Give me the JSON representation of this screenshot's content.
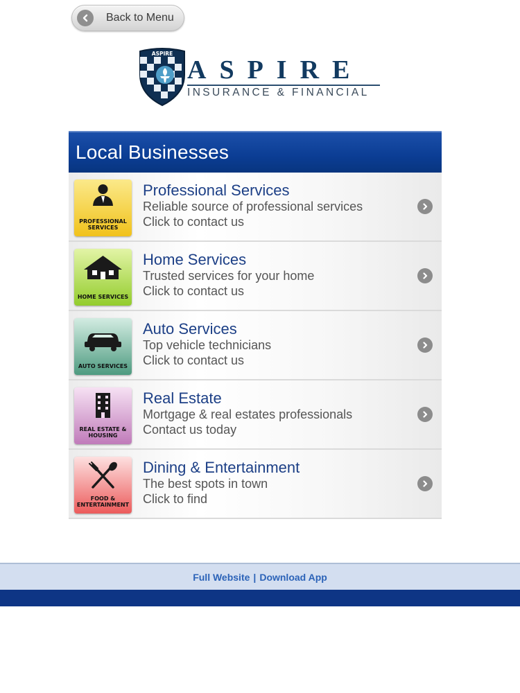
{
  "nav": {
    "back_label": "Back to Menu",
    "back_icon": "arrow-left-icon"
  },
  "logo": {
    "shield_text": "ASPIRE",
    "name": "ASPIRE",
    "tagline": "INSURANCE & FINANCIAL"
  },
  "section": {
    "title": "Local Businesses"
  },
  "items": [
    {
      "title": "Professional Services",
      "subtitle": "Reliable source of professional services",
      "action": "Click to contact us",
      "thumb_caption": "PROFESSIONAL SERVICES",
      "thumb_color": "#f7d23b",
      "icon": "businessman-icon"
    },
    {
      "title": "Home Services",
      "subtitle": "Trusted services for your home",
      "action": "Click to contact us",
      "thumb_caption": "HOME SERVICES",
      "thumb_color": "#a9d84a",
      "icon": "house-icon"
    },
    {
      "title": "Auto Services",
      "subtitle": "Top vehicle technicians",
      "action": "Click to contact us",
      "thumb_caption": "AUTO SERVICES",
      "thumb_color": "#5fa98f",
      "icon": "car-icon"
    },
    {
      "title": "Real Estate",
      "subtitle": "Mortgage & real estates professionals",
      "action": "Contact us today",
      "thumb_caption": "REAL ESTATE & HOUSING",
      "thumb_color": "#c88ac2",
      "icon": "building-icon"
    },
    {
      "title": "Dining & Entertainment",
      "subtitle": "The best spots in town",
      "action": "Click to find",
      "thumb_caption": "FOOD & ENTERTAINMENT",
      "thumb_color": "#f07a7a",
      "icon": "fork-spoon-icon"
    }
  ],
  "footer": {
    "full_website": "Full Website",
    "separator": "|",
    "download_app": "Download App"
  },
  "colors": {
    "header_blue": "#0b3d94",
    "title_blue": "#1c3f86",
    "footer_link": "#2c63b8"
  }
}
